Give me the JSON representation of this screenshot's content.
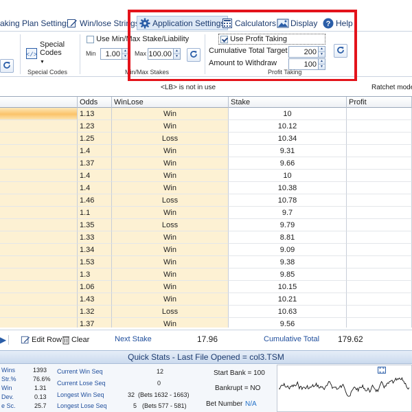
{
  "menu": {
    "tabs": [
      {
        "label": "aking Plan Settings",
        "icon": "staking-plan-icon"
      },
      {
        "label": "Win/lose Strings",
        "icon": "pencil-edit-icon"
      },
      {
        "label": "Application Settings",
        "icon": "gear-icon",
        "active": true
      },
      {
        "label": "Calculators",
        "icon": "calculator-icon"
      },
      {
        "label": "Display",
        "icon": "picture-icon"
      },
      {
        "label": "Help",
        "icon": "help-icon"
      }
    ]
  },
  "ribbon": {
    "special_codes": {
      "button_label_1": "Special",
      "button_label_2": "Codes",
      "group_label": "Special Codes"
    },
    "minmax": {
      "checkbox_label": "Use Min/Max Stake/Liability",
      "checked": false,
      "min_label": "Min",
      "min_value": "1.00",
      "max_label": "Max",
      "max_value": "100.00",
      "group_label": "Min/Max Stakes"
    },
    "profit_taking": {
      "checkbox_label": "Use Profit Taking",
      "checked": true,
      "cumulative_label": "Cumulative Total Target",
      "cumulative_value": "200",
      "withdraw_label": "Amount to Withdraw",
      "withdraw_value": "100",
      "group_label": "Profit Taking"
    }
  },
  "info": {
    "lb_note": "<LB> is not in use",
    "ratchet": "Ratchet mode -"
  },
  "grid": {
    "headers": [
      "",
      "Odds",
      "WinLose",
      "Stake",
      "Profit"
    ],
    "rows": [
      {
        "odds": "1.13",
        "result": "Win",
        "stake": "10"
      },
      {
        "odds": "1.23",
        "result": "Win",
        "stake": "10.12"
      },
      {
        "odds": "1.25",
        "result": "Loss",
        "stake": "10.34"
      },
      {
        "odds": "1.4",
        "result": "Win",
        "stake": "9.31"
      },
      {
        "odds": "1.37",
        "result": "Win",
        "stake": "9.66"
      },
      {
        "odds": "1.4",
        "result": "Win",
        "stake": "10"
      },
      {
        "odds": "1.4",
        "result": "Win",
        "stake": "10.38"
      },
      {
        "odds": "1.46",
        "result": "Loss",
        "stake": "10.78"
      },
      {
        "odds": "1.1",
        "result": "Win",
        "stake": "9.7"
      },
      {
        "odds": "1.35",
        "result": "Loss",
        "stake": "9.79"
      },
      {
        "odds": "1.33",
        "result": "Win",
        "stake": "8.81"
      },
      {
        "odds": "1.34",
        "result": "Win",
        "stake": "9.09"
      },
      {
        "odds": "1.53",
        "result": "Win",
        "stake": "9.38"
      },
      {
        "odds": "1.3",
        "result": "Win",
        "stake": "9.85"
      },
      {
        "odds": "1.06",
        "result": "Win",
        "stake": "10.15"
      },
      {
        "odds": "1.43",
        "result": "Win",
        "stake": "10.21"
      },
      {
        "odds": "1.32",
        "result": "Loss",
        "stake": "10.63"
      },
      {
        "odds": "1.37",
        "result": "Win",
        "stake": "9.56"
      }
    ]
  },
  "bottom": {
    "edit_row": "Edit Row",
    "clear": "Clear",
    "next_stake_label": "Next Stake",
    "next_stake_value": "17.96",
    "cumulative_label": "Cumulative Total",
    "cumulative_value": "179.62"
  },
  "quick_stats": {
    "title": "Quick Stats - Last File Opened = col3.TSM",
    "left": [
      {
        "label": "Wins",
        "value": "1393"
      },
      {
        "label": "Str.%",
        "value": "76.6%"
      },
      {
        "label": "Win",
        "value": "1.31"
      },
      {
        "label": "Dev.",
        "value": "0.13"
      },
      {
        "label": "e Sc.",
        "value": "25.7"
      }
    ],
    "seq": [
      {
        "label": "Current Win Seq",
        "value": "12",
        "extra": ""
      },
      {
        "label": "Current Lose Seq",
        "value": "0",
        "extra": ""
      },
      {
        "label": "Longest Win Seq",
        "value": "32",
        "extra": "(Bets 1632 - 1663)"
      },
      {
        "label": "Longest Lose Seq",
        "value": "5",
        "extra": "(Bets 577 - 581)"
      }
    ],
    "start_bank": "Start Bank = 100",
    "bankrupt": "Bankrupt = NO",
    "bet_number_label": "Bet Number",
    "bet_number_value": "N/A"
  },
  "colors": {
    "highlight": "#e3131b",
    "grid_fill": "#fdf1d3",
    "link": "#1f6fc8"
  }
}
